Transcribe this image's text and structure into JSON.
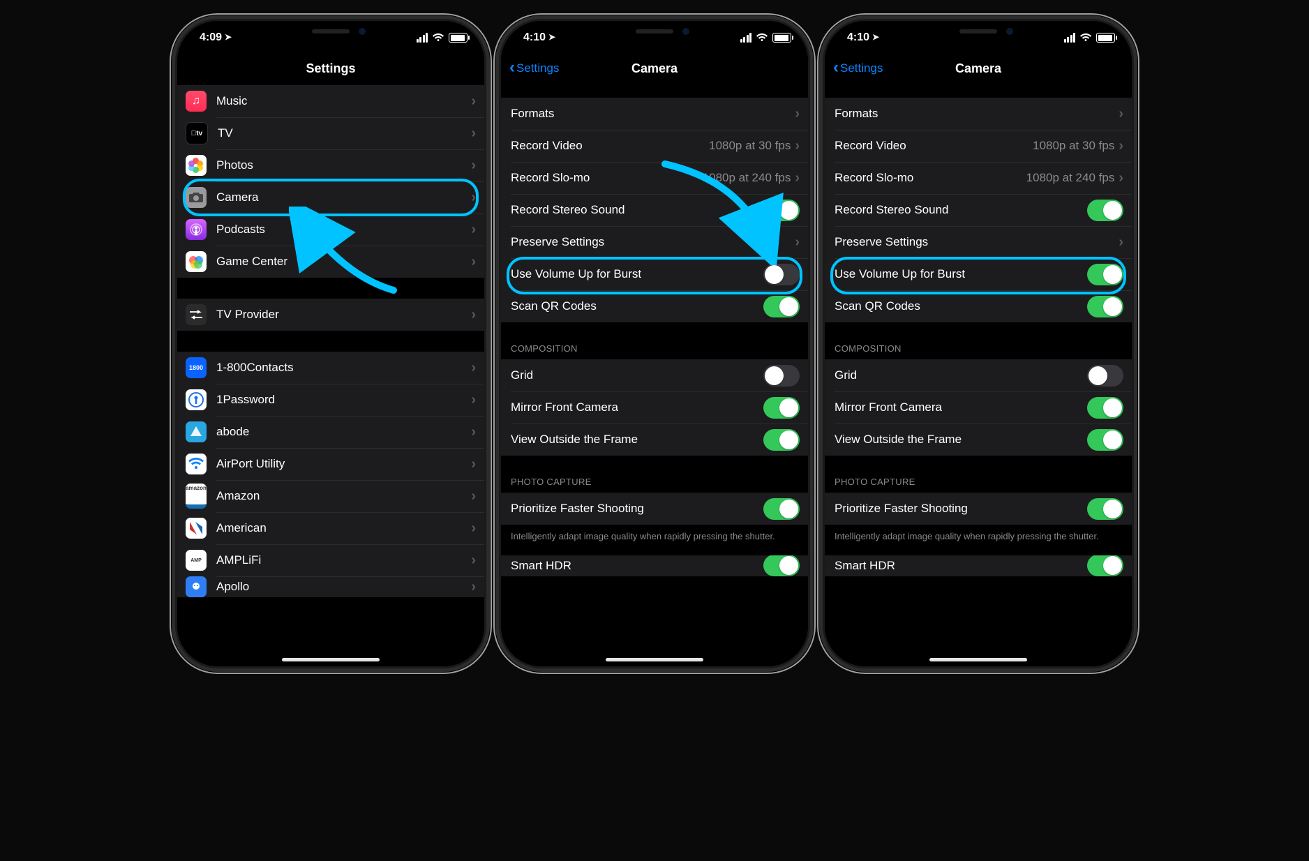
{
  "highlight_color": "#00c3ff",
  "screen1": {
    "time": "4:09",
    "title": "Settings",
    "groups": [
      [
        {
          "icon": "music",
          "label": "Music"
        },
        {
          "icon": "tv",
          "label": "TV"
        },
        {
          "icon": "photos",
          "label": "Photos"
        },
        {
          "icon": "camera",
          "label": "Camera",
          "highlighted": true
        },
        {
          "icon": "podcasts",
          "label": "Podcasts"
        },
        {
          "icon": "gamecenter",
          "label": "Game Center"
        }
      ],
      [
        {
          "icon": "tvprovider",
          "label": "TV Provider"
        }
      ],
      [
        {
          "icon": "1800contacts",
          "label": "1-800Contacts"
        },
        {
          "icon": "1password",
          "label": "1Password"
        },
        {
          "icon": "abode",
          "label": "abode"
        },
        {
          "icon": "airport",
          "label": "AirPort Utility"
        },
        {
          "icon": "amazon",
          "label": "Amazon"
        },
        {
          "icon": "american",
          "label": "American"
        },
        {
          "icon": "amplifi",
          "label": "AMPLiFi"
        },
        {
          "icon": "apollo",
          "label": "Apollo"
        }
      ]
    ]
  },
  "screen2": {
    "time": "4:10",
    "back": "Settings",
    "title": "Camera",
    "rows": {
      "formats": "Formats",
      "record_video": "Record Video",
      "record_video_val": "1080p at 30 fps",
      "record_slomo": "Record Slo-mo",
      "record_slomo_val": "1080p at 240 fps",
      "stereo": "Record Stereo Sound",
      "preserve": "Preserve Settings",
      "burst": "Use Volume Up for Burst",
      "qr": "Scan QR Codes",
      "composition_h": "COMPOSITION",
      "grid": "Grid",
      "mirror": "Mirror Front Camera",
      "outside": "View Outside the Frame",
      "capture_h": "PHOTO CAPTURE",
      "faster": "Prioritize Faster Shooting",
      "faster_foot": "Intelligently adapt image quality when rapidly pressing the shutter.",
      "smart_hdr": "Smart HDR"
    },
    "toggles": {
      "stereo": true,
      "burst": false,
      "qr": true,
      "grid": false,
      "mirror": true,
      "outside": true,
      "faster": true,
      "smart_hdr": true
    }
  },
  "screen3": {
    "time": "4:10",
    "back": "Settings",
    "title": "Camera",
    "toggles": {
      "stereo": true,
      "burst": true,
      "qr": true,
      "grid": false,
      "mirror": true,
      "outside": true,
      "faster": true,
      "smart_hdr": true
    }
  }
}
